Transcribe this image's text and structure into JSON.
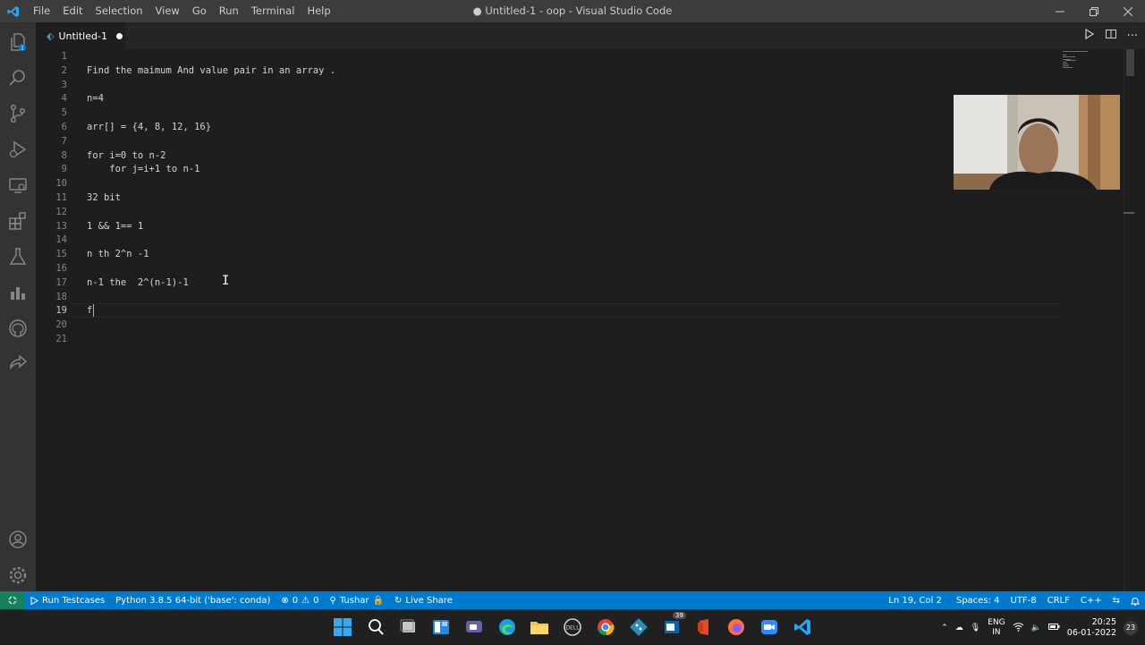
{
  "titlebar": {
    "menu": [
      "File",
      "Edit",
      "Selection",
      "View",
      "Go",
      "Run",
      "Terminal",
      "Help"
    ],
    "title": "● Untitled-1 - oop - Visual Studio Code"
  },
  "tab": {
    "label": "Untitled-1"
  },
  "editor": {
    "lines": [
      {
        "n": "1",
        "text": ""
      },
      {
        "n": "2",
        "text": "Find the maimum And value pair in an array ."
      },
      {
        "n": "3",
        "text": ""
      },
      {
        "n": "4",
        "text": "n=4"
      },
      {
        "n": "5",
        "text": ""
      },
      {
        "n": "6",
        "text": "arr[] = {4, 8, 12, 16}"
      },
      {
        "n": "7",
        "text": ""
      },
      {
        "n": "8",
        "text": "for i=0 to n-2"
      },
      {
        "n": "9",
        "text": "    for j=i+1 to n-1"
      },
      {
        "n": "10",
        "text": ""
      },
      {
        "n": "11",
        "text": "32 bit"
      },
      {
        "n": "12",
        "text": ""
      },
      {
        "n": "13",
        "text": "1 && 1== 1"
      },
      {
        "n": "14",
        "text": ""
      },
      {
        "n": "15",
        "text": "n th 2^n -1"
      },
      {
        "n": "16",
        "text": ""
      },
      {
        "n": "17",
        "text": "n-1 the  2^(n-1)-1"
      },
      {
        "n": "18",
        "text": ""
      },
      {
        "n": "19",
        "text": "f"
      },
      {
        "n": "20",
        "text": ""
      },
      {
        "n": "21",
        "text": ""
      }
    ]
  },
  "statusbar": {
    "run_testcases": "Run Testcases",
    "python": "Python 3.8.5 64-bit ('base': conda)",
    "errors": "0",
    "warnings": "0",
    "user": "Tushar",
    "live_share": "Live Share",
    "position": "Ln 19, Col 2",
    "spaces": "Spaces: 4",
    "encoding": "UTF-8",
    "eol": "CRLF",
    "language": "C++"
  },
  "taskbar": {
    "lang_top": "ENG",
    "lang_bottom": "IN",
    "time": "20:25",
    "date": "06-01-2022",
    "notif_count": "23",
    "badge": "39"
  },
  "colors": {
    "statusbar": "#007acc",
    "remote": "#16825d",
    "titlebar": "#3c3c3c",
    "activitybar": "#333333",
    "editor": "#1e1e1e"
  }
}
